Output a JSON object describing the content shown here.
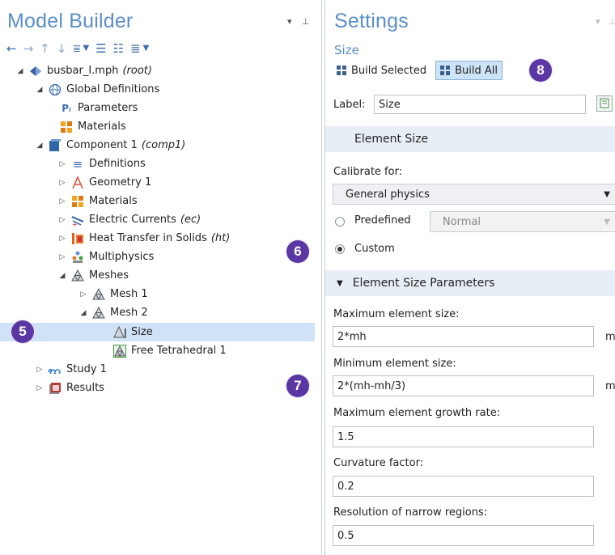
{
  "left_panel": {
    "title": "Model Builder",
    "toolbar_icons": [
      "back-arrow-icon",
      "forward-arrow-icon",
      "up-arrow-icon",
      "down-arrow-icon",
      "filter-icon",
      "expand-icon",
      "collapse-icon",
      "list-icon"
    ],
    "tree": [
      {
        "label": "busbar_I.mph",
        "tag": "(root)",
        "icon": "model-icon"
      },
      {
        "label": "Global Definitions",
        "icon": "globe-icon"
      },
      {
        "label": "Parameters",
        "icon": "parameters-icon"
      },
      {
        "label": "Materials",
        "icon": "materials-icon"
      },
      {
        "label": "Component 1",
        "tag": "(comp1)",
        "icon": "component-icon"
      },
      {
        "label": "Definitions",
        "icon": "definitions-icon"
      },
      {
        "label": "Geometry 1",
        "icon": "geometry-icon"
      },
      {
        "label": "Materials",
        "icon": "materials-icon"
      },
      {
        "label": "Electric Currents",
        "tag": "(ec)",
        "icon": "electric-currents-icon"
      },
      {
        "label": "Heat Transfer in Solids",
        "tag": "(ht)",
        "icon": "heat-transfer-icon"
      },
      {
        "label": "Multiphysics",
        "icon": "multiphysics-icon"
      },
      {
        "label": "Meshes",
        "icon": "meshes-icon"
      },
      {
        "label": "Mesh 1",
        "icon": "mesh-icon"
      },
      {
        "label": "Mesh 2",
        "icon": "mesh-icon"
      },
      {
        "label": "Size",
        "icon": "size-icon"
      },
      {
        "label": "Free Tetrahedral 1",
        "icon": "free-tetrahedral-icon"
      },
      {
        "label": "Study 1",
        "icon": "study-icon"
      },
      {
        "label": "Results",
        "icon": "results-icon"
      }
    ],
    "badges": [
      "5",
      "6",
      "7"
    ]
  },
  "right_panel": {
    "title": "Settings",
    "subtitle": "Size",
    "build_selected": "Build Selected",
    "build_all": "Build All",
    "badge": "8",
    "label_caption": "Label:",
    "label_value": "Size",
    "section_element_size": "Element Size",
    "calibrate_for": "Calibrate for:",
    "calibrate_value": "General physics",
    "predefined": "Predefined",
    "predefined_value": "Normal",
    "custom": "Custom",
    "section_parameters": "Element Size Parameters",
    "fields": [
      {
        "caption": "Maximum element size:",
        "value": "2*mh",
        "unit": "m"
      },
      {
        "caption": "Minimum element size:",
        "value": "2*(mh-mh/3)",
        "unit": "m"
      },
      {
        "caption": "Maximum element growth rate:",
        "value": "1.5"
      },
      {
        "caption": "Curvature factor:",
        "value": "0.2"
      },
      {
        "caption": "Resolution of narrow regions:",
        "value": "0.5"
      }
    ]
  },
  "colors": {
    "title_blue": "#5b8fc9",
    "badge_purple": "#5a37a3",
    "selection": "#cfe2f7",
    "section_bg": "#e8eef6"
  }
}
